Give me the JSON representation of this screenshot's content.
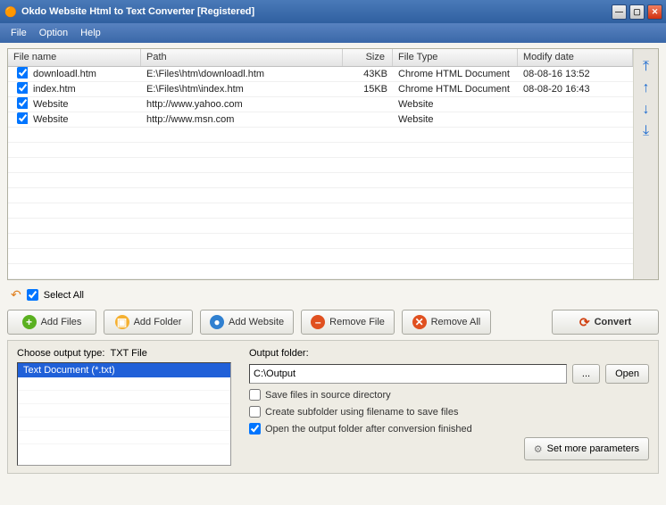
{
  "window": {
    "title": "Okdo Website Html to Text Converter [Registered]"
  },
  "menu": {
    "file": "File",
    "option": "Option",
    "help": "Help"
  },
  "columns": {
    "name": "File name",
    "path": "Path",
    "size": "Size",
    "type": "File Type",
    "date": "Modify date"
  },
  "files": [
    {
      "name": "downloadl.htm",
      "path": "E:\\Files\\htm\\downloadl.htm",
      "size": "43KB",
      "type": "Chrome HTML Document",
      "date": "08-08-16 13:52"
    },
    {
      "name": "index.htm",
      "path": "E:\\Files\\htm\\index.htm",
      "size": "15KB",
      "type": "Chrome HTML Document",
      "date": "08-08-20 16:43"
    },
    {
      "name": "Website",
      "path": "http://www.yahoo.com",
      "size": "",
      "type": "Website",
      "date": ""
    },
    {
      "name": "Website",
      "path": "http://www.msn.com",
      "size": "",
      "type": "Website",
      "date": ""
    }
  ],
  "selectall": "Select All",
  "buttons": {
    "addfiles": "Add Files",
    "addfolder": "Add Folder",
    "addwebsite": "Add Website",
    "removefile": "Remove File",
    "removeall": "Remove All",
    "convert": "Convert"
  },
  "output": {
    "choose_label": "Choose output type:",
    "choose_value": "TXT File",
    "type_item": "Text Document (*.txt)",
    "folder_label": "Output folder:",
    "folder_value": "C:\\Output",
    "browse": "...",
    "open": "Open",
    "save_source": "Save files in source directory",
    "create_sub": "Create subfolder using filename to save files",
    "open_after": "Open the output folder after conversion finished",
    "more": "Set more parameters"
  }
}
